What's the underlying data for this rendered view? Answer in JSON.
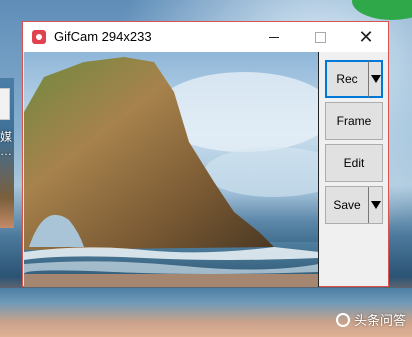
{
  "window": {
    "title": "GifCam 294x233"
  },
  "buttons": {
    "rec": "Rec",
    "frame": "Frame",
    "edit": "Edit",
    "save": "Save"
  },
  "desktop": {
    "icon_label_1": "媒",
    "icon_label_2": "…",
    "watermark": "头条问答"
  },
  "icons": {
    "app": "gifcam-camera-icon",
    "minimize": "minimize-icon",
    "maximize": "maximize-icon",
    "close": "close-icon",
    "rec_dropdown": "chevron-down-icon",
    "save_dropdown": "chevron-down-icon"
  },
  "colors": {
    "window_border": "#d9534f",
    "focus_border": "#0078d7"
  }
}
